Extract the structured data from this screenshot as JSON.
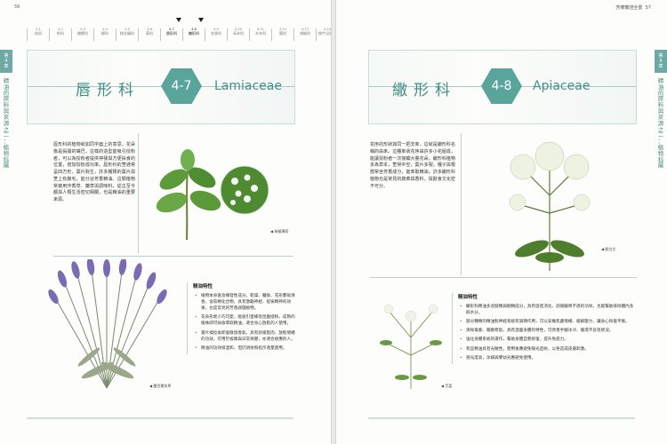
{
  "left_page": {
    "page_number": "56",
    "side_chip": "第\n4\n章",
    "side_text": "精油的原料與來源之二：植物科屬",
    "tabs": [
      {
        "n": "4-1",
        "label": "松科"
      },
      {
        "n": "4-2",
        "label": "柏科"
      },
      {
        "n": "4-3",
        "label": "橄欖科"
      },
      {
        "n": "4-4",
        "label": "樟科"
      },
      {
        "n": "4-5",
        "label": "桃金孃科"
      },
      {
        "n": "4-6",
        "label": "菊科"
      },
      {
        "n": "4-7",
        "label": "唇形科"
      },
      {
        "n": "4-8",
        "label": "繖形科"
      },
      {
        "n": "4-9",
        "label": "芸香科"
      },
      {
        "n": "4-10",
        "label": "禾本科"
      },
      {
        "n": "4-11",
        "label": "木本科"
      },
      {
        "n": "4-12",
        "label": "薑科"
      },
      {
        "n": "4-13",
        "label": "胡椒科"
      },
      {
        "n": "4-14",
        "label": "牻牛兒苗科"
      },
      {
        "n": "4-15",
        "label": "其他科"
      }
    ],
    "family_cn": "唇形科",
    "family_no": "4-7",
    "family_latin": "Lamiaceae",
    "intro": "唇形科的植物就如同字面上的意思，花朵像是張開的嘴巴，這樣的造型能吸引授粉者，可以為授粉者提供停棲與方便採食的位置，增加授粉成功率。唇形科的莖通常呈四方形，葉片對生，許多種類的葉片與莖上有腺毛，能分泌芳香精油。這類植物常被用作香草、藥草與調味料，從古至今都與人類生活密切相關，也是精油的重要來源。",
    "caption_mint": "胡椒薄荷",
    "caption_lavender": "醒目薰衣草",
    "essential_heading": "精油特性",
    "essential_items": [
      "植物本身富含揮發性成分，乾燥、曬後、花形都很清香，含萜類化合物，具有激勵神經、提振精神的效果，也是常見的芳香調理植物。",
      "花朵形狀小巧可愛，能吸引蜜蜂等昆蟲授粉，成熟的植株即可採收萃取精油，適合身心放鬆的人使用。",
      "葉片揉捻後即會散發香氣，具有舒緩肌肉、放鬆情緒的功效，可用於按摩與日常保健，亦適合疲憊的人。",
      "精油的功效很溫和，但仍須依照指示適量使用。"
    ]
  },
  "right_page": {
    "page_number": "57",
    "running_head": "芳療實證全書",
    "side_chip": "第\n4\n章",
    "side_text": "精油的原料與來源之二：植物科屬",
    "family_cn": "繖形科",
    "family_no": "4-8",
    "family_latin": "Apiaceae",
    "intro": "花序的形狀如同一把支傘，這就是繖形科名稱的由來。這種傘狀花序由許多小花組成，能讓授粉者一次接觸大量花朵。繖形科植物多為草本，莖常中空，葉片多裂，種子與根部常含芳香成分，能萃取精油。許多繖形科植物也是常見的蔬菜與香料，與飲食文化密不可分。",
    "caption_angelica": "歐白芷",
    "caption_coriander": "芫荽",
    "essential_heading": "精油特性",
    "essential_items": [
      "繖形科精油多含醚類與酮類成分，具有促進消化、舒緩腸胃不適的功效，也能幫助排除體內多餘水分。",
      "部分種類的精油對神經系統有調節作用，可以安撫焦慮情緒、緩解壓力，讓身心恢復平衡。",
      "清除毒素、驅散寒氣，具有溫暖身體的特性，可改善手腳冰冷、循環不良等狀況。",
      "強化身體系統的運作，幫助身體自我修復，提升免疫力。",
      "有些精油具有光敏性，使用後應避免陽光直射，以免造成皮膚刺激。",
      "感光度高，孕婦與嬰幼兒應避免使用。"
    ]
  }
}
